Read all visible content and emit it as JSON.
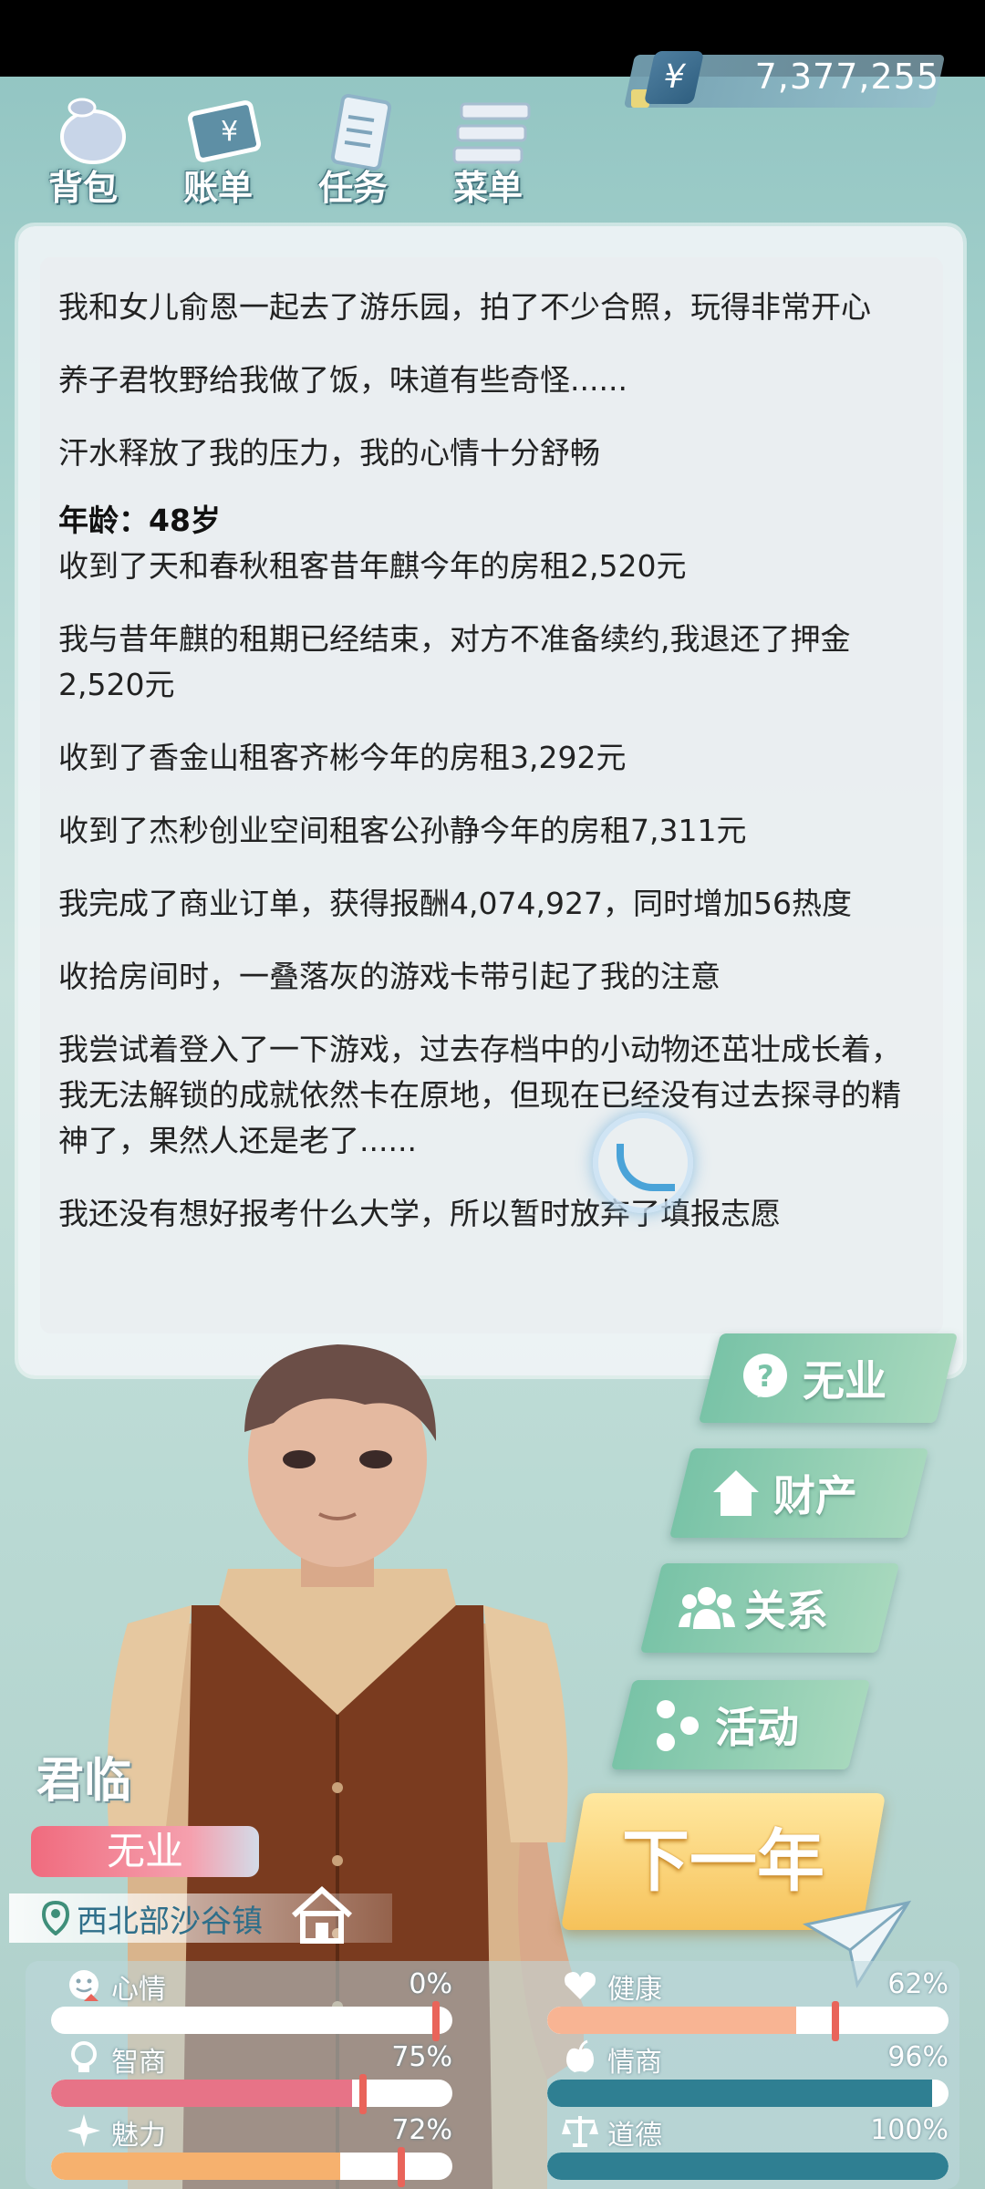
{
  "nav": {
    "items": [
      {
        "label": "背包",
        "icon": "backpack-icon"
      },
      {
        "label": "账单",
        "icon": "bill-icon"
      },
      {
        "label": "任务",
        "icon": "task-icon"
      },
      {
        "label": "菜单",
        "icon": "menu-icon"
      }
    ],
    "money": {
      "symbol": "¥",
      "value": "7,377,255"
    }
  },
  "log": {
    "lines_before_age": [
      "我和女儿俞恩一起去了游乐园，拍了不少合照，玩得非常开心",
      "养子君牧野给我做了饭，味道有些奇怪......",
      "汗水释放了我的压力，我的心情十分舒畅"
    ],
    "age": "年龄：48岁",
    "lines_after_age": [
      "收到了天和春秋租客昔年麒今年的房租2,520元",
      "我与昔年麒的租期已经结束，对方不准备续约,我退还了押金2,520元",
      "收到了香金山租客齐彬今年的房租3,292元",
      "收到了杰秒创业空间租客公孙静今年的房租7,311元",
      "我完成了商业订单，获得报酬4,074,927，同时增加56热度",
      "收拾房间时，一叠落灰的游戏卡带引起了我的注意",
      "我尝试着登入了一下游戏，过去存档中的小动物还茁壮成长着，我无法解锁的成就依然卡在原地，但现在已经没有过去探寻的精神了，果然人还是老了......",
      "我还没有想好报考什么大学，所以暂时放弃了填报志愿"
    ]
  },
  "actions": {
    "job": "无业",
    "assets": "财产",
    "relations": "关系",
    "activities": "活动",
    "next_year": "下一年"
  },
  "character": {
    "name": "君临",
    "job_badge": "无业",
    "location": "西北部沙谷镇"
  },
  "stats": {
    "mood": {
      "name": "心情",
      "value": "0%",
      "level": 0.0
    },
    "health": {
      "name": "健康",
      "value": "62%",
      "level": 0.62
    },
    "iq": {
      "name": "智商",
      "value": "75%",
      "level": 0.75
    },
    "eq": {
      "name": "情商",
      "value": "96%",
      "level": 0.96
    },
    "charm": {
      "name": "魅力",
      "value": "72%",
      "level": 0.72
    },
    "morality": {
      "name": "道德",
      "value": "100%",
      "level": 1.0
    }
  },
  "colors": {
    "accent_green": "#79c3a7",
    "next_button": "#f6c25a",
    "job_badge": "#f06b7e",
    "mood_fill": "#f3f5f6",
    "health_fill": "#f8b493",
    "iq_fill": "#e77387",
    "eq_fill": "#2f7f92",
    "charm_fill": "#f6b16e",
    "morality_fill": "#2f7f92"
  }
}
